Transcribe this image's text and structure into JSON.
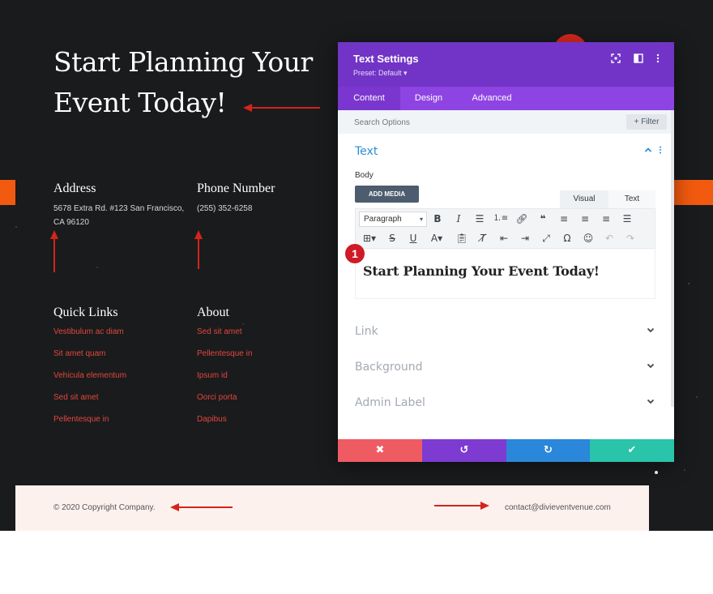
{
  "page": {
    "headline": "Start Planning Your Event Today!",
    "address": {
      "title": "Address",
      "text": "5678 Extra Rd. #123 San Francisco, CA 96120"
    },
    "phone": {
      "title": "Phone Number",
      "text": "(255) 352-6258"
    },
    "quick_links": {
      "title": "Quick Links",
      "items": [
        "Vestibulum ac diam",
        "Sit amet quam",
        "Vehicula elementum",
        "Sed sit amet",
        "Pellentesque in"
      ]
    },
    "about": {
      "title": "About",
      "items": [
        "Sed sit amet",
        "Pellentesque in",
        "Ipsum id",
        "Oorci porta",
        "Dapibus"
      ]
    },
    "footer": {
      "copyright": "© 2020 Copyright Company.",
      "contact": "contact@divieventvenue.com"
    }
  },
  "modal": {
    "title": "Text Settings",
    "preset": "Preset: Default ▾",
    "header_icons": [
      "focus-icon",
      "split-view-icon",
      "more-options-icon"
    ],
    "tabs": [
      {
        "label": "Content",
        "active": true
      },
      {
        "label": "Design",
        "active": false
      },
      {
        "label": "Advanced",
        "active": false
      }
    ],
    "search": {
      "placeholder": "Search Options",
      "filter_label": "+ Filter"
    },
    "text_section": {
      "title": "Text",
      "body_label": "Body",
      "add_media_label": "ADD MEDIA",
      "editor_tabs": [
        "Visual",
        "Text"
      ],
      "paragraph_select": "Paragraph",
      "toolbar_row1_icons": [
        "bold-icon",
        "italic-icon",
        "bullet-list-icon",
        "numbered-list-icon",
        "link-icon",
        "blockquote-icon",
        "align-left-icon",
        "align-center-icon",
        "align-right-icon",
        "justify-icon"
      ],
      "toolbar_row2_icons": [
        "table-icon",
        "strikethrough-icon",
        "underline-icon",
        "text-color-icon",
        "paste-icon",
        "clear-format-icon",
        "outdent-icon",
        "indent-icon",
        "fullscreen-icon",
        "special-char-icon",
        "emoji-icon",
        "undo-icon",
        "redo-icon"
      ],
      "editor_content": "Start Planning Your Event Today!"
    },
    "collapsed_sections": [
      "Link",
      "Background",
      "Admin Label"
    ],
    "bottom_buttons": [
      {
        "name": "discard",
        "symbol": "✖",
        "color": "#ef5b63"
      },
      {
        "name": "undo",
        "symbol": "↺",
        "color": "#7d3bd1"
      },
      {
        "name": "redo",
        "symbol": "↻",
        "color": "#2b87da"
      },
      {
        "name": "save",
        "symbol": "✔",
        "color": "#29c4a9"
      }
    ]
  },
  "annotation": {
    "badge": "1"
  },
  "colors": {
    "purple_header": "#7234c7",
    "purple_tabs": "#8e44e3",
    "link_red": "#e1473d",
    "accent_orange": "#f25a0f",
    "arrow_red": "#d4241c"
  }
}
